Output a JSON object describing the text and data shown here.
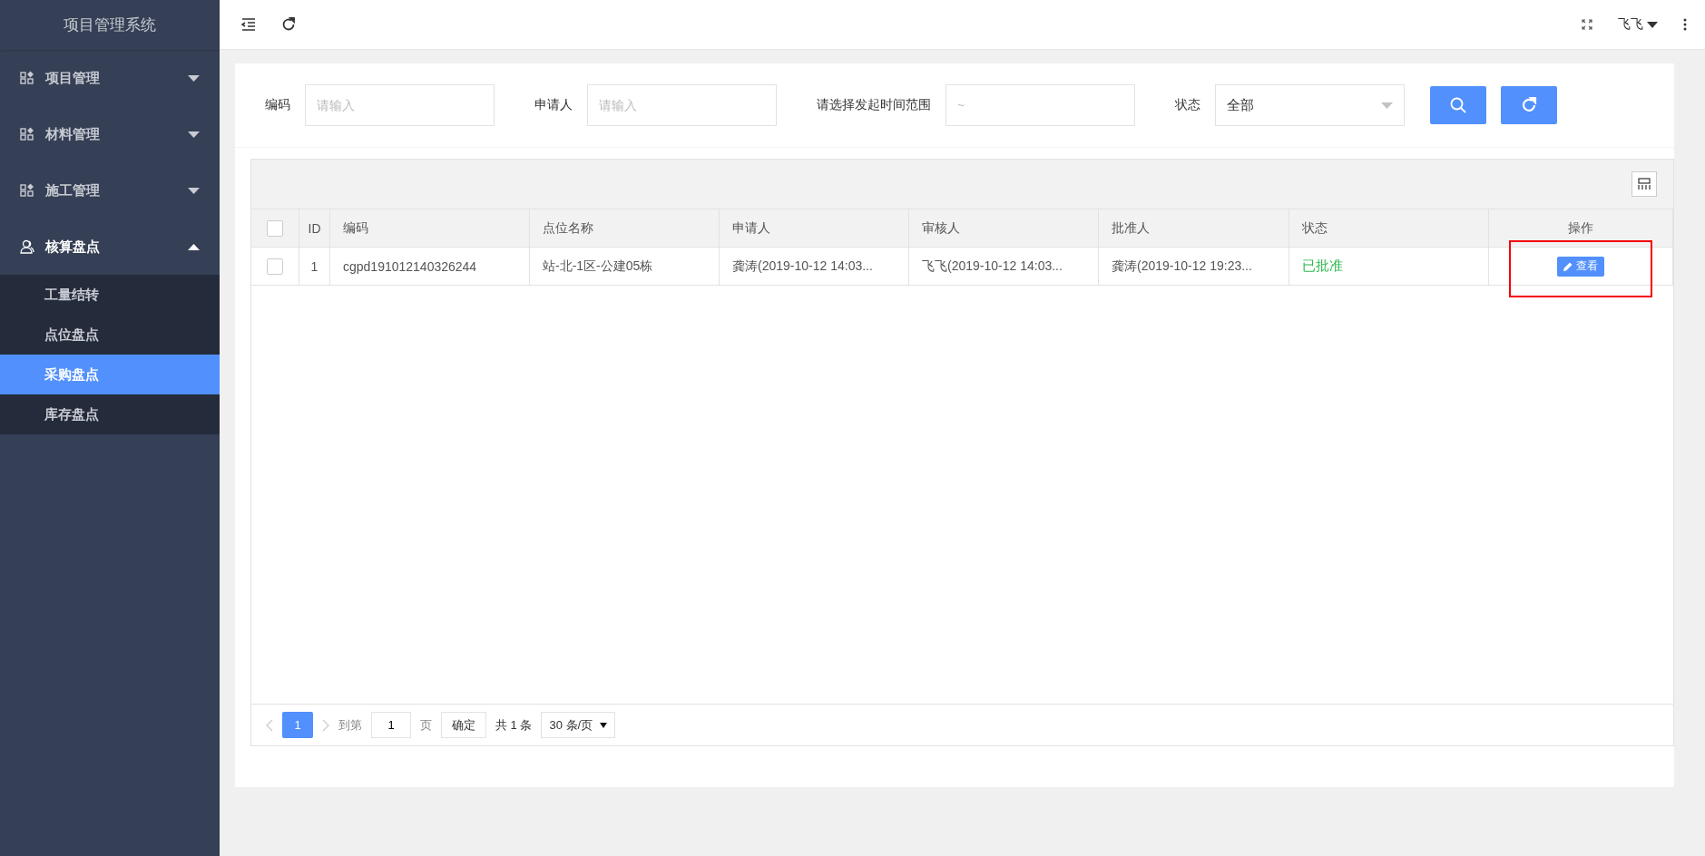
{
  "sidebar": {
    "title": "项目管理系统",
    "items": [
      {
        "label": "项目管理",
        "kind": "module",
        "expanded": false
      },
      {
        "label": "材料管理",
        "kind": "module",
        "expanded": false
      },
      {
        "label": "施工管理",
        "kind": "module",
        "expanded": false
      },
      {
        "label": "核算盘点",
        "kind": "people",
        "expanded": true,
        "children": [
          {
            "label": "工量结转",
            "selected": false
          },
          {
            "label": "点位盘点",
            "selected": false
          },
          {
            "label": "采购盘点",
            "selected": true
          },
          {
            "label": "库存盘点",
            "selected": false
          }
        ]
      }
    ]
  },
  "topbar": {
    "user": "飞飞"
  },
  "filters": [
    {
      "kind": "input",
      "label": "编码",
      "placeholder": "请输入"
    },
    {
      "kind": "input",
      "label": "申请人",
      "placeholder": "请输入"
    },
    {
      "kind": "range",
      "label": "请选择发起时间范围",
      "placeholder": "~"
    },
    {
      "kind": "select",
      "label": "状态",
      "value": "全部"
    }
  ],
  "table": {
    "header_checked": false,
    "columns": [
      "ID",
      "编码",
      "点位名称",
      "申请人",
      "审核人",
      "批准人",
      "状态",
      "操作"
    ],
    "rows": [
      {
        "checked": false,
        "cells": [
          "1",
          "cgpd191012140326244",
          "站-北-1区-公建05栋",
          "龚涛(2019-10-12 14:03...",
          "飞飞(2019-10-12 14:03...",
          "龚涛(2019-10-12 19:23..."
        ],
        "status": "已批准",
        "color": "#2db84d",
        "action": "查看",
        "annotated": true
      }
    ]
  },
  "pagination": {
    "pages": [
      {
        "label": "1",
        "selected": true
      }
    ],
    "goto_label": "到第",
    "goto_value": "1",
    "page_unit": "页",
    "confirm": "确定",
    "total": "共 1 条",
    "page_size": "30 条/页"
  }
}
